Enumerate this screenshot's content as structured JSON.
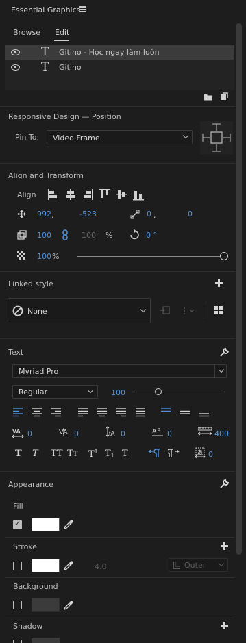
{
  "panel": {
    "title": "Essential Graphics"
  },
  "tabs": [
    {
      "label": "Browse"
    },
    {
      "label": "Edit",
      "active": true
    }
  ],
  "layers": [
    {
      "name": "Gitiho - Học ngay làm luôn",
      "selected": true
    },
    {
      "name": "Gitiho",
      "selected": false
    }
  ],
  "responsive": {
    "title": "Responsive Design — Position",
    "pin_label": "Pin To:",
    "pin_value": "Video Frame"
  },
  "align_transform": {
    "title": "Align and Transform",
    "align_label": "Align",
    "pos_x": "992",
    "pos_y": "-523",
    "anchor_x": "0",
    "anchor_y": "0",
    "scale": "100",
    "scale_h": "100",
    "percent": "%",
    "rotation": "0 °",
    "opacity": "100",
    "opacity_unit": "%",
    "opacity_level": 1.0
  },
  "linked_style": {
    "title": "Linked style",
    "value": "None"
  },
  "text": {
    "title": "Text",
    "font": "Myriad Pro",
    "style": "Regular",
    "size": "100",
    "size_level": 0.27,
    "tracking": "0",
    "kerning": "0",
    "leading": "0",
    "baseline": "0",
    "tab_width": "400",
    "tsume": "0"
  },
  "appearance": {
    "title": "Appearance",
    "fill_label": "Fill",
    "stroke_label": "Stroke",
    "stroke_width": "4.0",
    "stroke_type": "Outer",
    "background_label": "Background",
    "shadow_label": "Shadow"
  },
  "colors": {
    "bg": "#1d1d1d",
    "accent": "#4d95e6",
    "fill": "#ffffff",
    "stroke": "#ffffff",
    "background_swatch": "#3b3b3b"
  }
}
